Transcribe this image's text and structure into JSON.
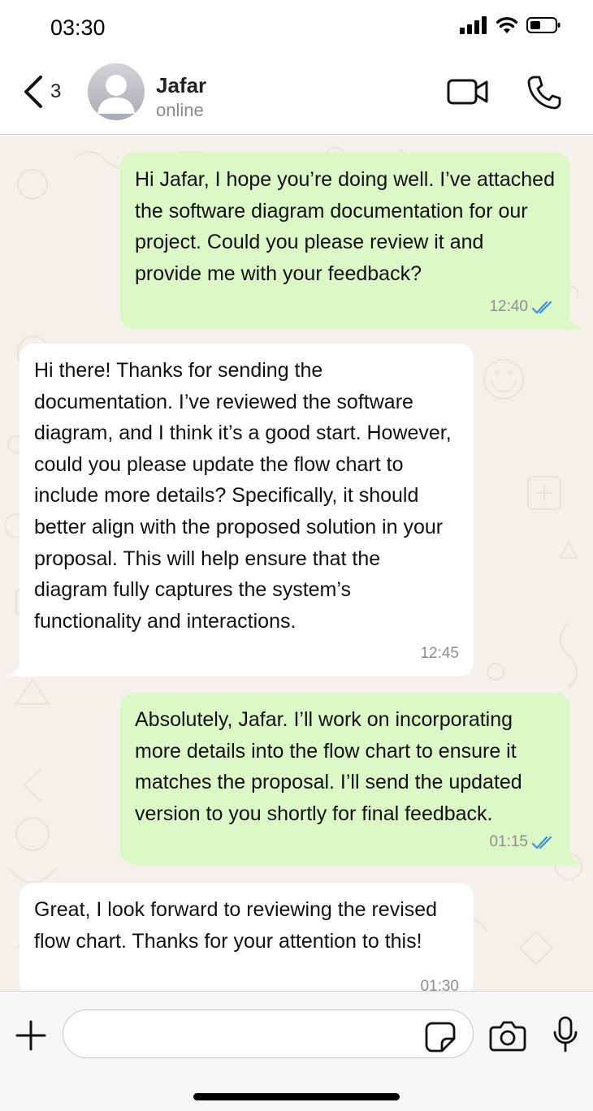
{
  "status_bar": {
    "time": "03:30"
  },
  "header": {
    "back_count": "3",
    "contact_name": "Jafar",
    "contact_status": "online"
  },
  "messages": [
    {
      "direction": "outgoing",
      "text": "Hi Jafar, I hope you’re doing well. I’ve attached the software diagram documentation for our project. Could you please review it and provide me with your feedback?",
      "time": "12:40",
      "read": true
    },
    {
      "direction": "incoming",
      "text": "Hi there! Thanks for sending the documentation. I’ve reviewed the software diagram, and I think it’s a good start. However, could you please update the flow chart to include more details? Specifically, it should better align with the proposed solution in your proposal. This will help ensure that the diagram fully captures the system’s functionality and interactions.",
      "time": "12:45"
    },
    {
      "direction": "outgoing",
      "text": "Absolutely, Jafar. I’ll work on incorporating more details into the flow chart to ensure it matches the proposal. I’ll send the updated version to you shortly for final feedback.",
      "time": "01:15",
      "read": true
    },
    {
      "direction": "incoming",
      "text": "Great, I look forward to reviewing the revised flow chart. Thanks for your attention to this!",
      "time": "01:30"
    }
  ],
  "input": {
    "placeholder": "",
    "value": ""
  },
  "colors": {
    "outgoing_bubble": "#dcf8c6",
    "incoming_bubble": "#ffffff",
    "chat_background": "#f3f1ea",
    "read_ticks": "#3d8fe0"
  },
  "icons": {
    "back": "chevron-left-icon",
    "video": "video-camera-icon",
    "call": "phone-icon",
    "add": "plus-icon",
    "sticker": "sticker-icon",
    "camera": "camera-icon",
    "mic": "microphone-icon"
  }
}
